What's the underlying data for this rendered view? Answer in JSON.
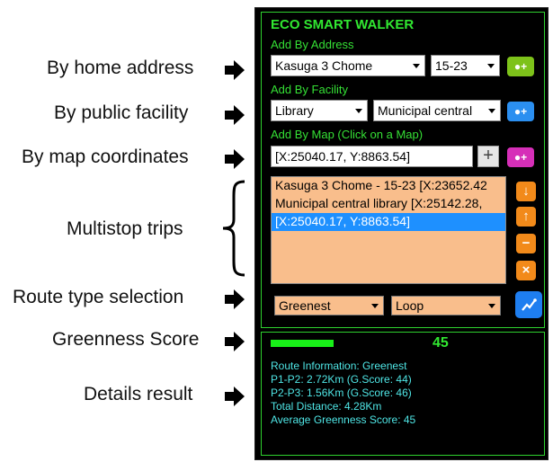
{
  "annotations": [
    {
      "label": "By home address"
    },
    {
      "label": "By public facility"
    },
    {
      "label": "By map coordinates"
    },
    {
      "label": "Multistop trips"
    },
    {
      "label": "Route type selection"
    },
    {
      "label": "Greenness Score"
    },
    {
      "label": "Details result"
    }
  ],
  "panel": {
    "title": "ECO SMART WALKER",
    "address": {
      "heading": "Add By Address",
      "street": "Kasuga 3 Chome",
      "number": "15-23"
    },
    "facility": {
      "heading": "Add By Facility",
      "type": "Library",
      "name": "Municipal central"
    },
    "map": {
      "heading": "Add By Map (Click on a Map)",
      "coords": "[X:25040.17, Y:8863.54]",
      "plus": "+"
    },
    "add_icon": "add-user-icon",
    "trips": [
      "Kasuga 3 Chome - 15-23 [X:23652.42",
      "Municipal central library [X:25142.28,",
      "[X:25040.17, Y:8863.54]"
    ],
    "route_type": "Greenest",
    "route_shape": "Loop",
    "score": {
      "value": "45",
      "level": 0.45
    },
    "details": [
      "Route Information: Greenest",
      "P1-P2: 2.72Km (G.Score: 44)",
      "P2-P3: 1.56Km (G.Score: 46)",
      "Total Distance: 4.28Km",
      "Average Greenness Score: 45"
    ]
  },
  "colors": {
    "accent_green": "#31e831",
    "details_text": "#4fe6e6",
    "orange": "#f28a1a",
    "list_bg": "#f9be8c"
  }
}
